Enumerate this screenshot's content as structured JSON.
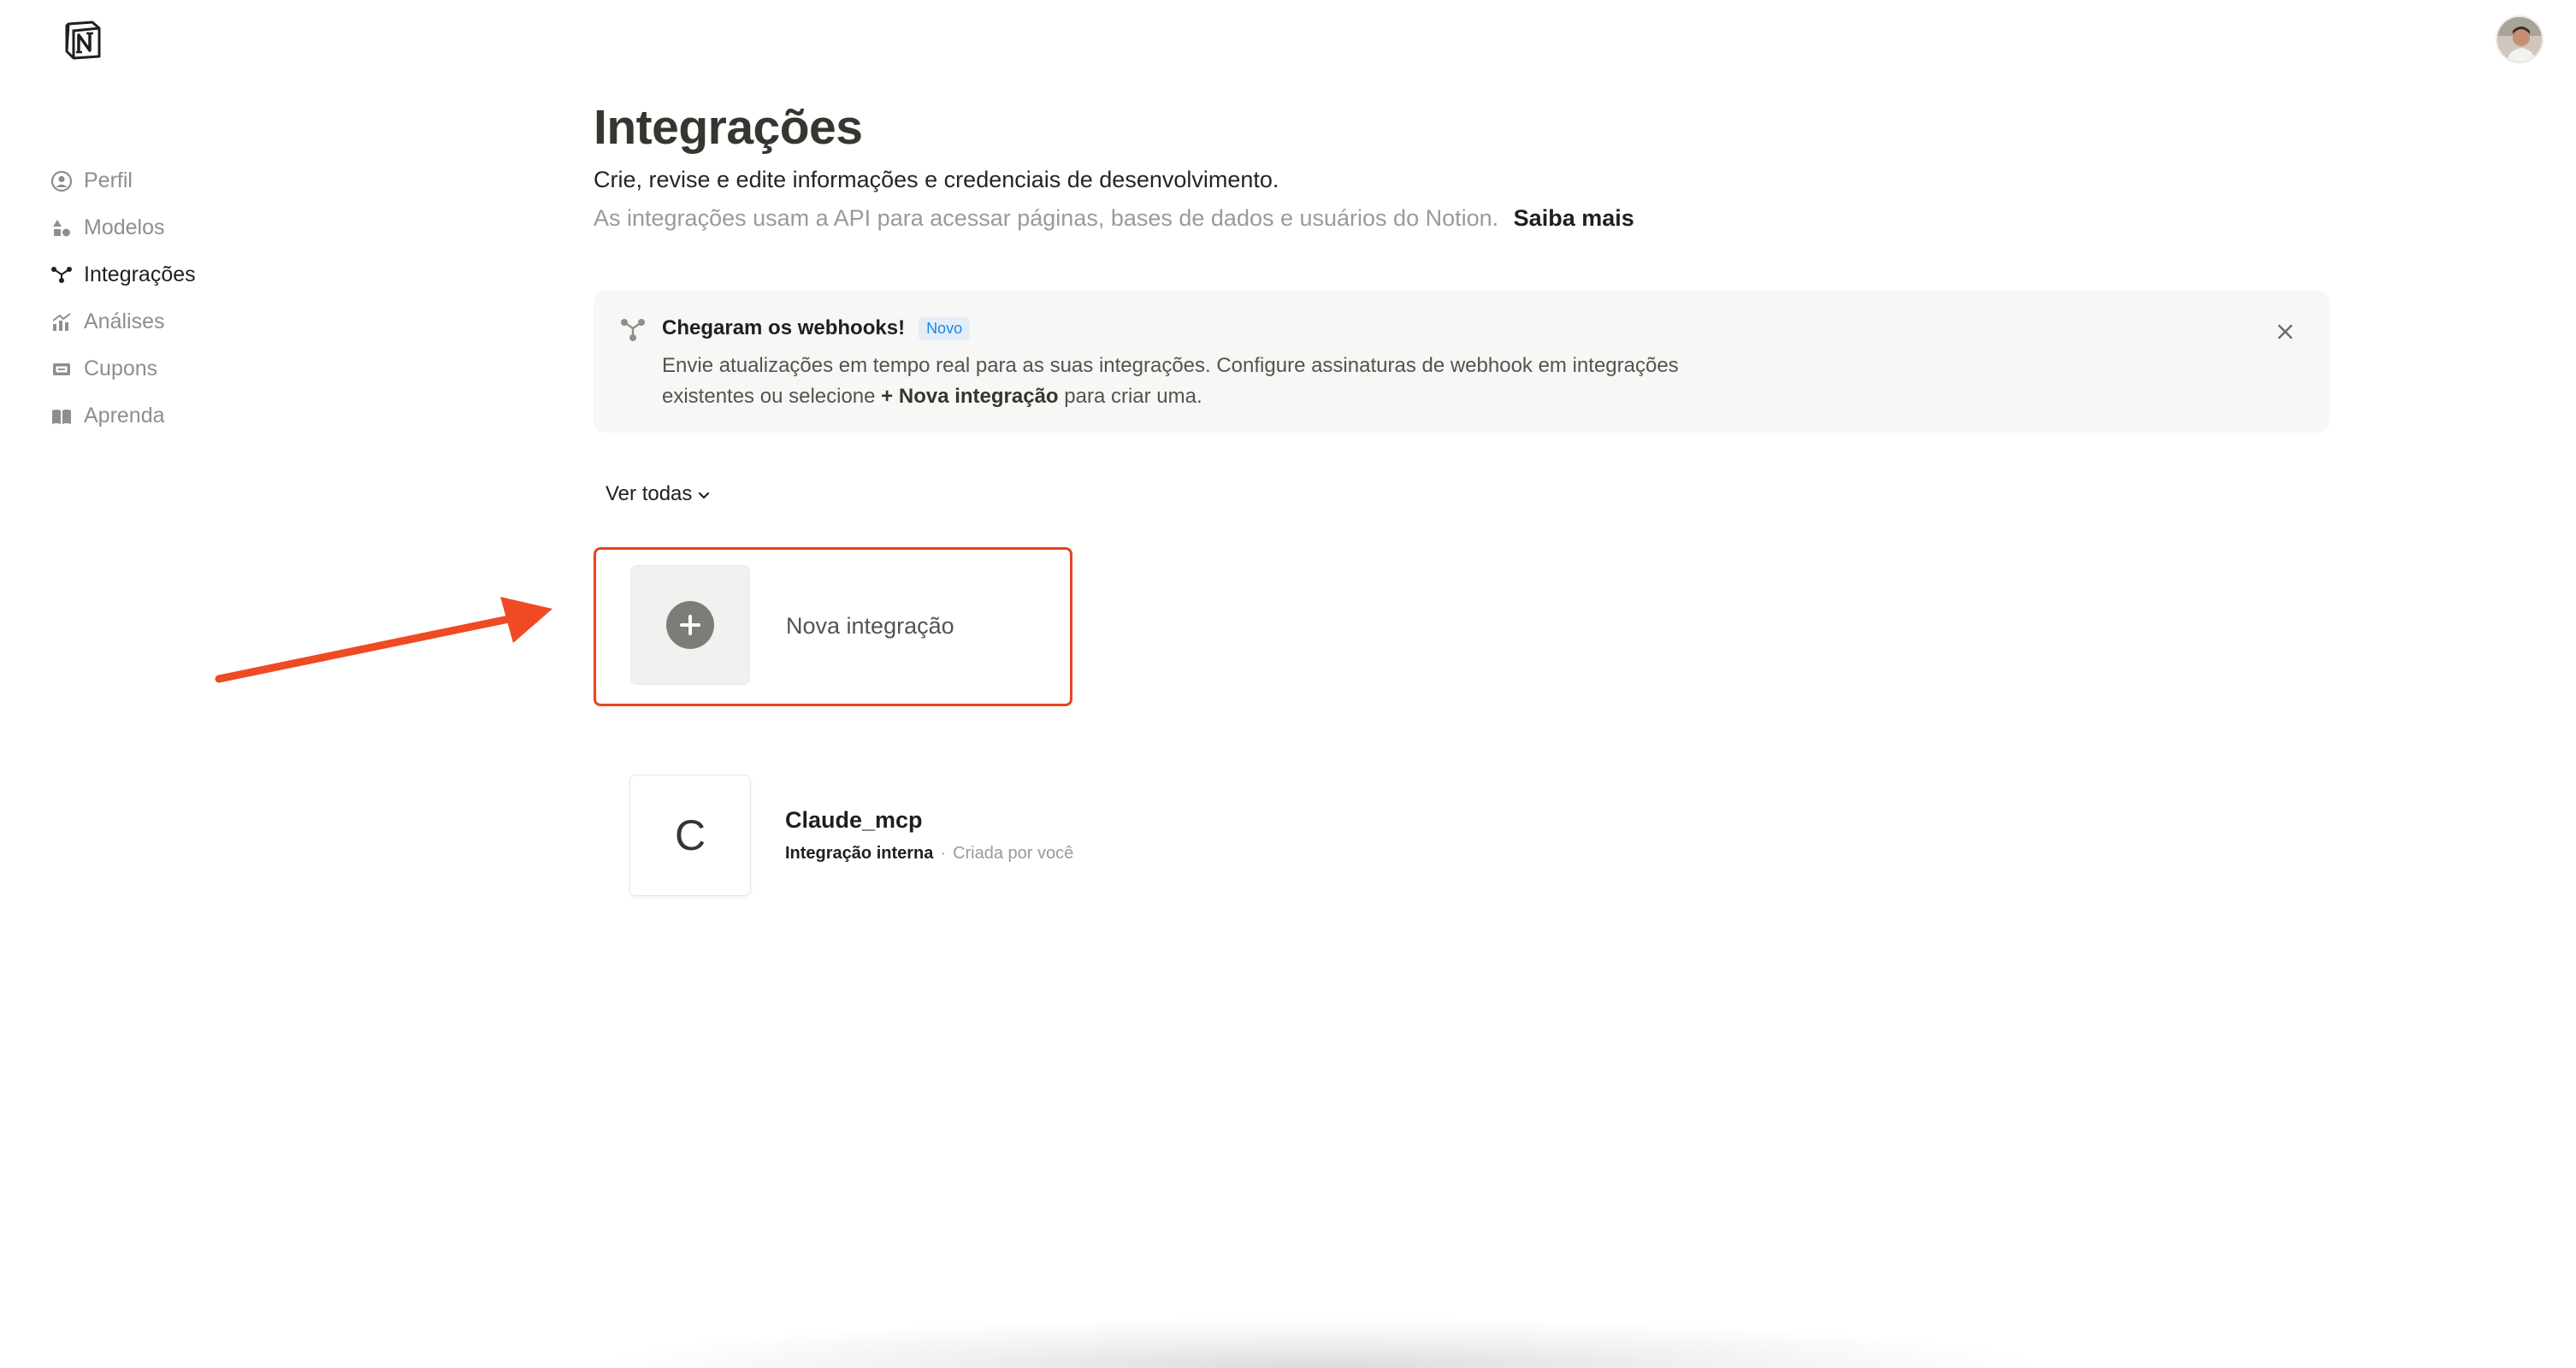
{
  "sidebar": {
    "items": [
      {
        "label": "Perfil",
        "icon": "profile-icon",
        "active": false
      },
      {
        "label": "Modelos",
        "icon": "shapes-icon",
        "active": false
      },
      {
        "label": "Integrações",
        "icon": "integrations-icon",
        "active": true
      },
      {
        "label": "Análises",
        "icon": "analytics-icon",
        "active": false
      },
      {
        "label": "Cupons",
        "icon": "coupon-icon",
        "active": false
      },
      {
        "label": "Aprenda",
        "icon": "book-icon",
        "active": false
      }
    ]
  },
  "main": {
    "title": "Integrações",
    "subtitle": "Crie, revise e edite informações e credenciais de desenvolvimento.",
    "description": "As integrações usam a API para acessar páginas, bases de dados e usuários do Notion.",
    "learn_more": "Saiba mais"
  },
  "banner": {
    "title": "Chegaram os webhooks!",
    "badge": "Novo",
    "text_part1": "Envie atualizações em tempo real para as suas integrações. Configure assinaturas de webhook em integrações existentes ou selecione",
    "text_bold": "+ Nova integração",
    "text_part2": "para criar uma."
  },
  "filter": {
    "label": "Ver todas"
  },
  "new_integration": {
    "label": "Nova integração"
  },
  "integrations": [
    {
      "initial": "C",
      "name": "Claude_mcp",
      "type": "Integração interna",
      "separator": "·",
      "created_by": "Criada por você"
    }
  ],
  "colors": {
    "highlight": "#e8441f",
    "arrow": "#ef4a23",
    "badge_bg": "#e3eef9",
    "badge_text": "#2383e2"
  }
}
